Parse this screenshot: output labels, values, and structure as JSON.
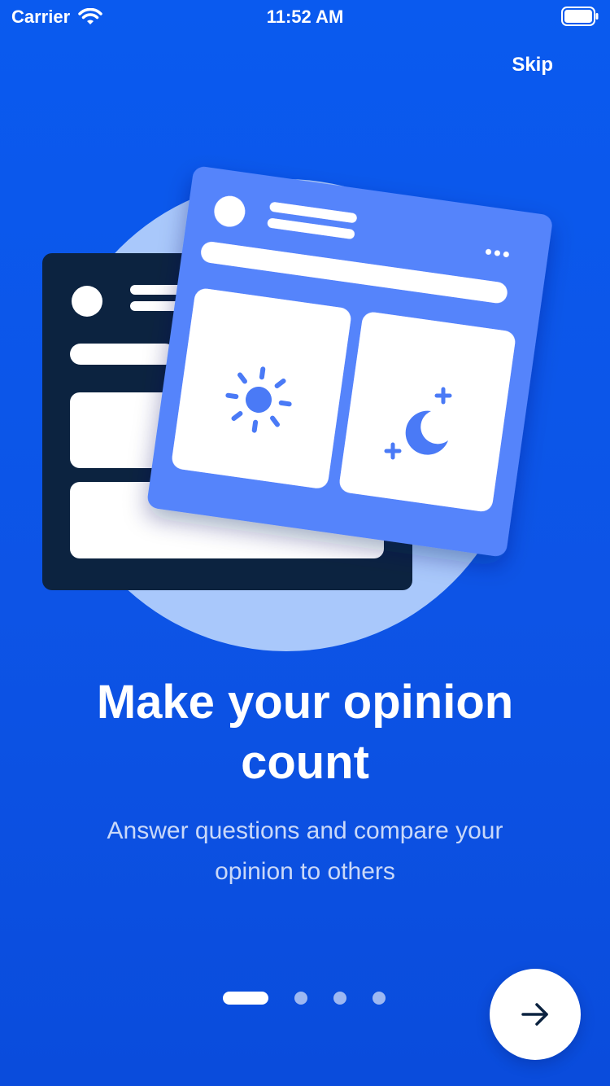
{
  "status_bar": {
    "carrier": "Carrier",
    "time": "11:52 AM"
  },
  "header": {
    "skip_label": "Skip"
  },
  "onboarding": {
    "title_line1": "Make your opinion",
    "title_line2": "count",
    "subtitle_line1": "Answer questions and compare your",
    "subtitle_line2": "opinion to others",
    "page_count": 4,
    "current_page": 1
  },
  "icons": {
    "wifi": "wifi-icon",
    "battery": "battery-icon",
    "sun": "sun-icon",
    "moon": "moon-icon",
    "next": "arrow-right-icon"
  },
  "colors": {
    "background": "#0a5aef",
    "dark_card": "#0c2340",
    "light_card": "#5584fb",
    "circle": "#a9c8fb",
    "accent_icon": "#4a7af6",
    "arrow": "#0c2340"
  }
}
